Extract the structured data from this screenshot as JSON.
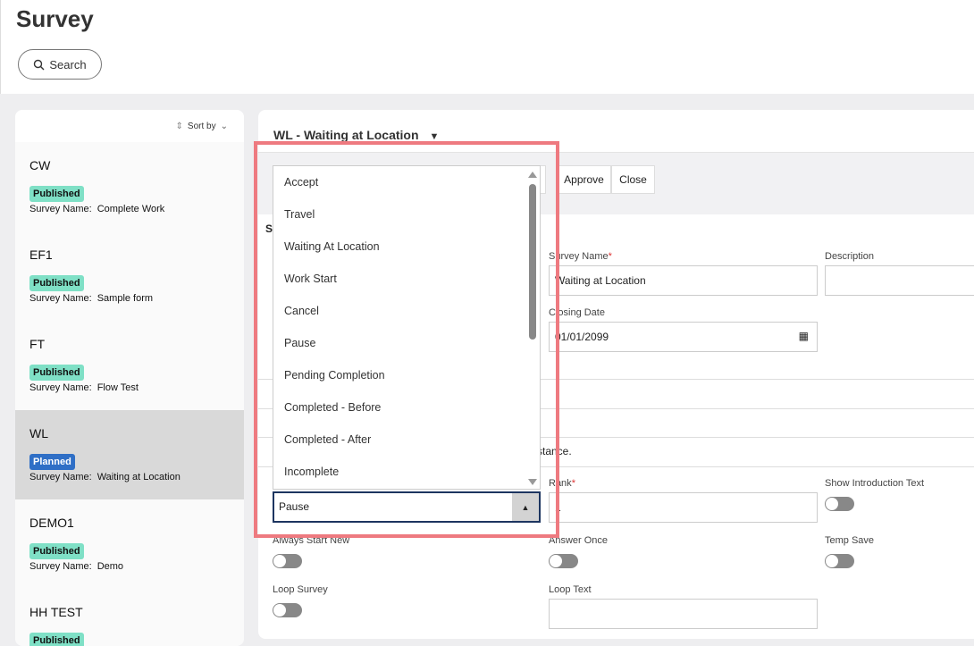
{
  "page": {
    "title": "Survey",
    "search_label": "Search"
  },
  "list": {
    "sort_label": "Sort by",
    "survey_name_label": "Survey Name:",
    "items": [
      {
        "code": "CW",
        "status": "Published",
        "name": "Complete Work"
      },
      {
        "code": "EF1",
        "status": "Published",
        "name": "Sample form"
      },
      {
        "code": "FT",
        "status": "Published",
        "name": "Flow Test"
      },
      {
        "code": "WL",
        "status": "Planned",
        "name": "Waiting at Location"
      },
      {
        "code": "DEMO1",
        "status": "Published",
        "name": "Demo"
      },
      {
        "code": "HH TEST",
        "status": "Published",
        "name": ""
      }
    ]
  },
  "detail": {
    "title": "WL - Waiting at Location",
    "approve": "Approve",
    "close": "Close",
    "section_initial": "S",
    "partial_text": "stance.",
    "survey_name_label": "Survey Name",
    "survey_name_value": "Waiting at Location",
    "description_label": "Description",
    "closing_date_label": "Closing Date",
    "closing_date_value": "01/01/2099",
    "rank_label": "Rank",
    "rank_value": "1",
    "show_intro_label": "Show Introduction Text",
    "always_start_new_label": "Always Start New",
    "answer_once_label": "Answer Once",
    "temp_save_label": "Temp Save",
    "loop_survey_label": "Loop Survey",
    "loop_text_label": "Loop Text",
    "required_mark": "*"
  },
  "dropdown": {
    "selected": "Pause",
    "options": [
      "Accept",
      "Travel",
      "Waiting At Location",
      "Work Start",
      "Cancel",
      "Pause",
      "Pending Completion",
      "Completed - Before",
      "Completed - After",
      "Incomplete"
    ]
  },
  "colors": {
    "published": "#7fe0c6",
    "planned": "#2f6fc6",
    "highlight": "#ee7a80"
  }
}
